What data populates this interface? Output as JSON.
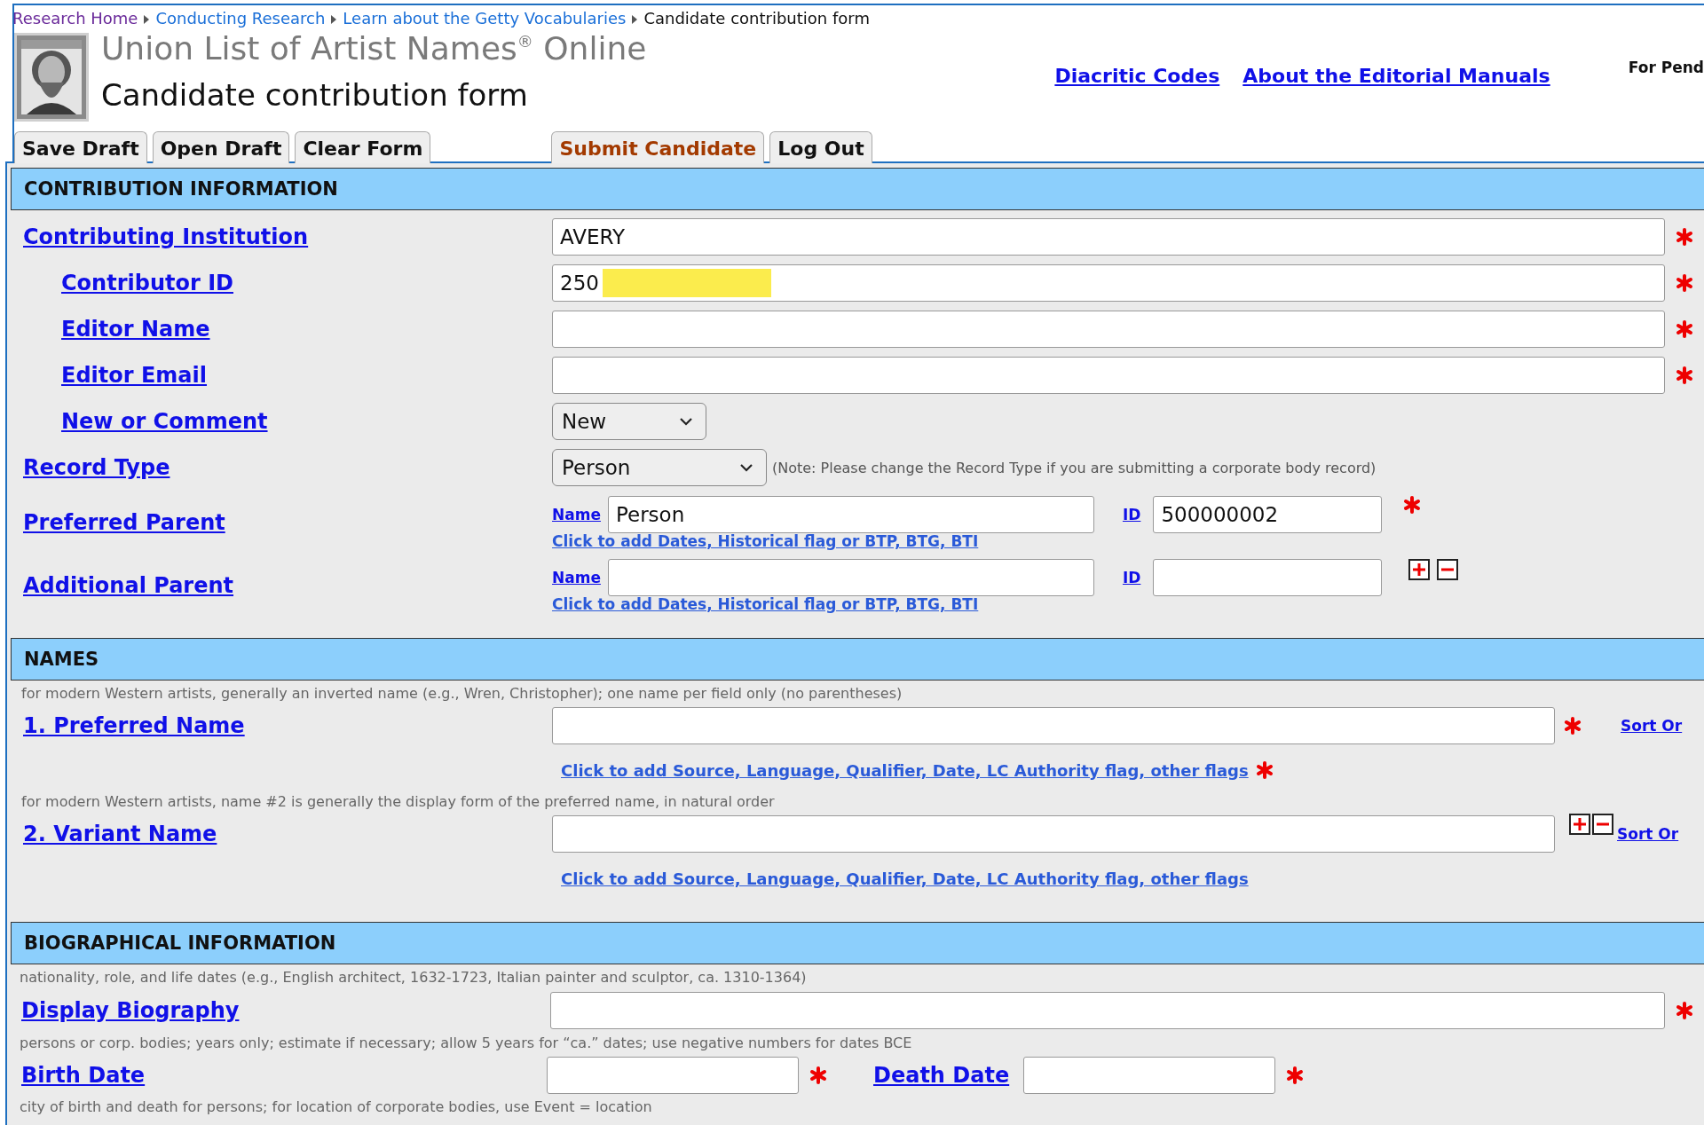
{
  "breadcrumb": [
    {
      "label": "Research Home",
      "kind": "link",
      "visited": true
    },
    {
      "label": "Conducting Research",
      "kind": "link",
      "visited": false
    },
    {
      "label": "Learn about the Getty Vocabularies",
      "kind": "link",
      "visited": false
    },
    {
      "label": "Candidate contribution form",
      "kind": "current",
      "visited": false
    }
  ],
  "title": "Union List of Artist Names$^{®}$ Online",
  "subtitle": "Candidate contribution form",
  "header_links": [
    "Diacritic Codes",
    "About the Editorial Manuals"
  ],
  "notice": "For Pend",
  "toolbar": [
    {
      "label": "Save Draft",
      "kind": "normal"
    },
    {
      "label": "Open Draft",
      "kind": "normal"
    },
    {
      "label": "Clear Form",
      "kind": "normal"
    },
    {
      "label": "Submit Candidate",
      "kind": "submit"
    },
    {
      "label": "Log Out",
      "kind": "normal"
    }
  ],
  "sections": [
    {
      "title": "CONTRIBUTION INFORMATION",
      "rows": [
        {
          "kind": "text",
          "label": "Contributing Institution",
          "value": "AVERY",
          "required": true,
          "children": [
            {
              "kind": "text",
              "label": "Contributor ID",
              "value": "250",
              "redacted": true,
              "required": true
            },
            {
              "kind": "text",
              "label": "Editor Name",
              "required": true
            },
            {
              "kind": "text",
              "label": "Editor Email",
              "required": true
            },
            {
              "kind": "select",
              "label": "New or Comment",
              "value": "New"
            }
          ]
        },
        {
          "kind": "select",
          "label": "Record Type",
          "value": "Person",
          "note": "(Note: Please change the Record Type if you are submitting a corporate body record)"
        },
        {
          "kind": "parent",
          "label": "Preferred Parent",
          "name_label": "Name",
          "name_value": "Person",
          "id_label": "ID",
          "id_value": "500000002",
          "required": true,
          "link": "Click to add Dates, Historical flag or BTP, BTG, BTI",
          "add_remove": false
        },
        {
          "kind": "parent",
          "label": "Additional Parent",
          "name_label": "Name",
          "id_label": "ID",
          "required": false,
          "link": "Click to add Dates, Historical flag or BTP, BTG, BTI",
          "add_remove": true
        }
      ]
    },
    {
      "title": "NAMES",
      "rows": [
        {
          "kind": "name",
          "hint": "for modern Western artists, generally an inverted name (e.g., Wren, Christopher); one name per field only (no parentheses)",
          "label": "1. Preferred Name",
          "required": true,
          "add_remove": false,
          "sort": "Sort Or",
          "link": "Click to add Source, Language, Qualifier, Date, LC Authority flag, other flags",
          "link_required": true
        },
        {
          "kind": "name",
          "hint": "for modern Western artists, name #2 is generally the display form of the preferred name, in natural order",
          "label": "2. Variant Name",
          "required": false,
          "add_remove": true,
          "sort": "Sort Or",
          "link": "Click to add Source, Language, Qualifier, Date, LC Authority flag, other flags",
          "link_required": false
        }
      ]
    },
    {
      "title": "BIOGRAPHICAL INFORMATION",
      "rows": [
        {
          "kind": "text",
          "hint": "nationality, role, and life dates (e.g., English architect, 1632-1723, Italian painter and sculptor, ca. 1310-1364)",
          "label": "Display Biography",
          "required": true
        },
        {
          "kind": "dates",
          "hint": "persons or corp. bodies; years only; estimate if necessary; allow 5 years for “ca.” dates; use negative numbers for dates BCE",
          "label": "Birth Date",
          "required": true,
          "second_label": "Death Date",
          "second_required": true
        },
        {
          "kind": "hint",
          "hint": "city of birth and death for persons; for location of corporate bodies, use Event = location"
        }
      ]
    }
  ]
}
